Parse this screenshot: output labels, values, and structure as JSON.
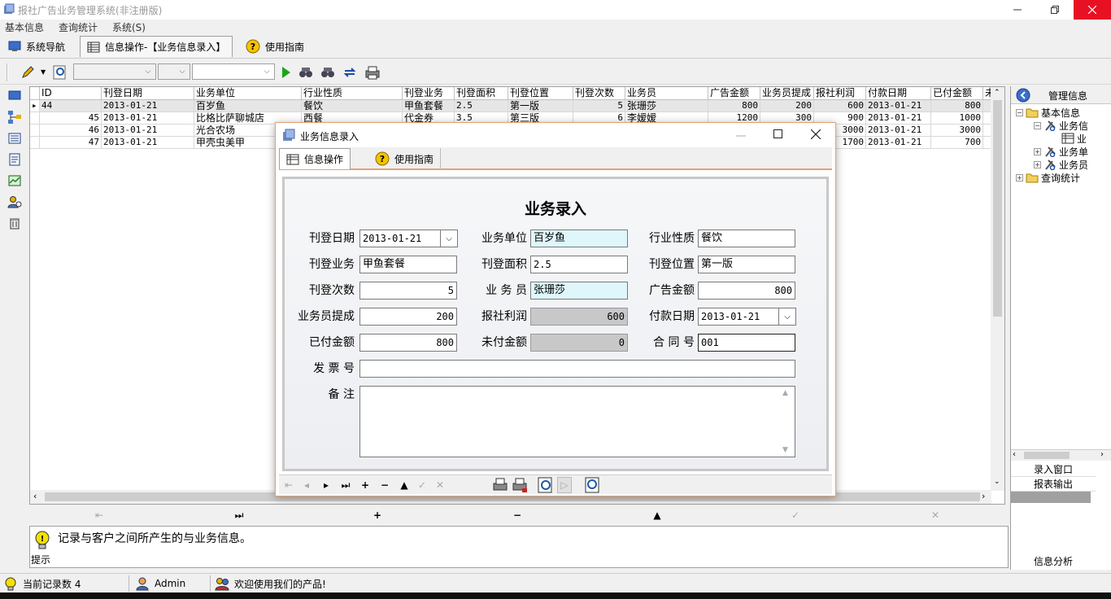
{
  "app": {
    "title": "报社广告业务管理系统(非注册版)"
  },
  "menu": [
    "基本信息",
    "查询统计",
    "系统(S)"
  ],
  "tabs": [
    {
      "label": "系统导航",
      "icon": "monitor-icon"
    },
    {
      "label": "信息操作-【业务信息录入】",
      "icon": "table-icon"
    },
    {
      "label": "使用指南",
      "icon": "help-icon"
    }
  ],
  "grid": {
    "columns": [
      "ID",
      "刊登日期",
      "业务单位",
      "行业性质",
      "刊登业务",
      "刊登面积",
      "刊登位置",
      "刊登次数",
      "业务员",
      "广告金额",
      "业务员提成",
      "报社利润",
      "付款日期",
      "已付金额",
      "未付"
    ],
    "rows": [
      [
        "44",
        "2013-01-21",
        "百岁鱼",
        "餐饮",
        "甲鱼套餐",
        "2.5",
        "第一版",
        "5",
        "张珊莎",
        "800",
        "200",
        "600",
        "2013-01-21",
        "800",
        ""
      ],
      [
        "45",
        "2013-01-21",
        "比格比萨聊城店",
        "西餐",
        "代金券",
        "3.5",
        "第三版",
        "6",
        "李嫒嫒",
        "1200",
        "300",
        "900",
        "2013-01-21",
        "1000",
        ""
      ],
      [
        "46",
        "2013-01-21",
        "光合农场",
        "",
        "",
        "",
        "",
        "",
        "",
        "",
        "",
        "3000",
        "2013-01-21",
        "3000",
        ""
      ],
      [
        "47",
        "2013-01-21",
        "甲壳虫美甲",
        "",
        "",
        "",
        "",
        "",
        "",
        "",
        "",
        "1700",
        "2013-01-21",
        "700",
        ""
      ]
    ]
  },
  "tip": {
    "text": "记录与客户之间所产生的与业务信息。",
    "label": "提示"
  },
  "right_panel": {
    "title": "管理信息",
    "tree": [
      {
        "label": "基本信息",
        "level": 0,
        "expander": "−"
      },
      {
        "label": "业务信",
        "level": 1,
        "expander": "−"
      },
      {
        "label": "业",
        "level": 2,
        "expander": ""
      },
      {
        "label": "业务单",
        "level": 1,
        "expander": "+"
      },
      {
        "label": "业务员",
        "level": 1,
        "expander": "+"
      },
      {
        "label": "查询统计",
        "level": 0,
        "expander": "+"
      }
    ],
    "buttons": [
      "录入窗口",
      "报表输出"
    ],
    "footer": "信息分析"
  },
  "status": {
    "records": "当前记录数 4",
    "user": "Admin",
    "welcome": "欢迎使用我们的产品!"
  },
  "dialog": {
    "title": "业务信息录入",
    "tabs": [
      "信息操作",
      "使用指南"
    ],
    "form_title": "业务录入",
    "fields": {
      "pub_date": {
        "label": "刊登日期",
        "value": "2013-01-21"
      },
      "company": {
        "label": "业务单位",
        "value": "百岁鱼"
      },
      "industry": {
        "label": "行业性质",
        "value": "餐饮"
      },
      "business": {
        "label": "刊登业务",
        "value": "甲鱼套餐"
      },
      "area": {
        "label": "刊登面积",
        "value": "2.5"
      },
      "position": {
        "label": "刊登位置",
        "value": "第一版"
      },
      "times": {
        "label": "刊登次数",
        "value": "5"
      },
      "salesman": {
        "label": "业 务 员",
        "value": "张珊莎"
      },
      "amount": {
        "label": "广告金额",
        "value": "800"
      },
      "commission": {
        "label": "业务员提成",
        "value": "200"
      },
      "profit": {
        "label": "报社利润",
        "value": "600"
      },
      "pay_date": {
        "label": "付款日期",
        "value": "2013-01-21"
      },
      "paid": {
        "label": "已付金额",
        "value": "800"
      },
      "unpaid": {
        "label": "未付金额",
        "value": "0"
      },
      "contract": {
        "label": "合 同 号",
        "value": "001"
      },
      "invoice": {
        "label": "发 票 号",
        "value": ""
      },
      "remark": {
        "label": "备   注",
        "value": ""
      }
    }
  },
  "colors": {
    "close_button": "#e81123",
    "dialog_border": "#e3a173",
    "highlight_field": "#dff7fb",
    "readonly_field": "#c8c8c8"
  }
}
